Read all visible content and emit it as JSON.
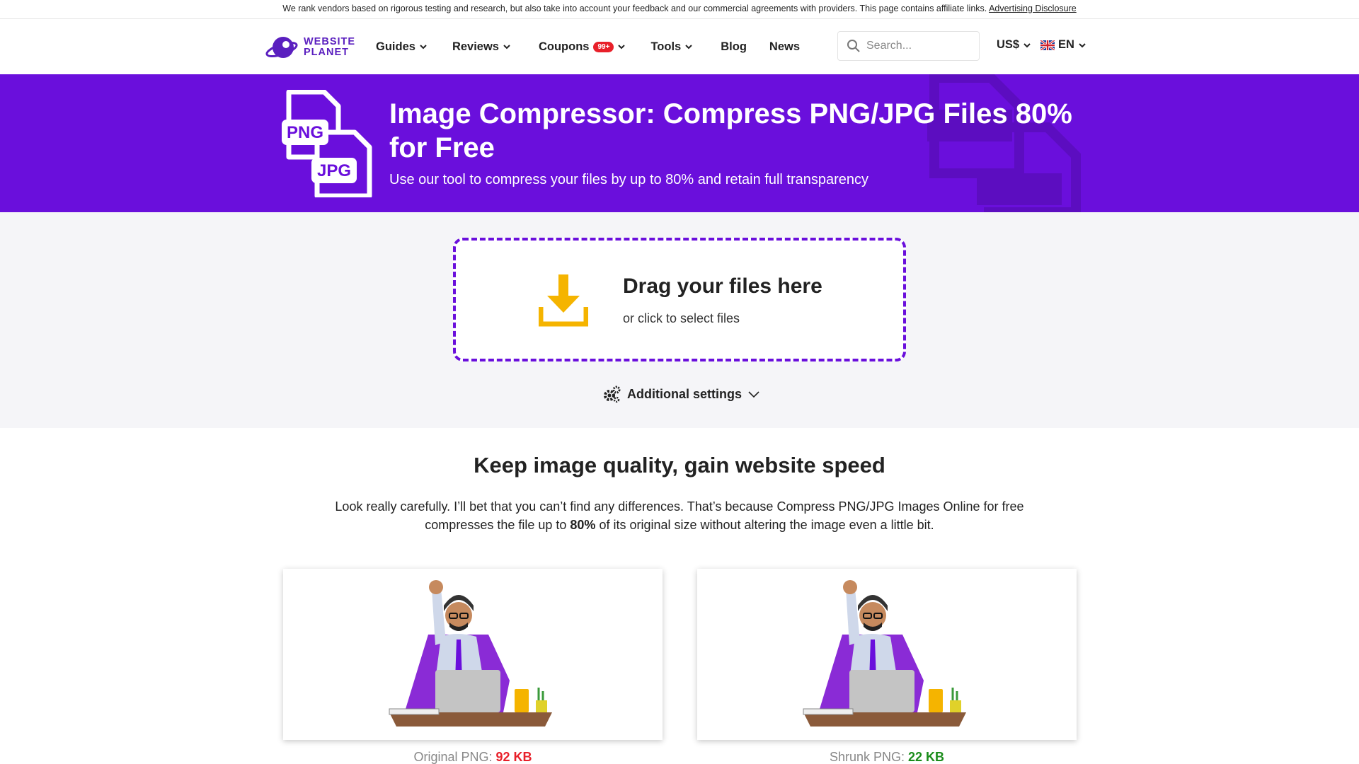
{
  "disclosure": {
    "text": "We rank vendors based on rigorous testing and research, but also take into account your feedback and our commercial agreements with providers. This page contains affiliate links.",
    "link": "Advertising Disclosure"
  },
  "header": {
    "logo_line1": "WEBSITE",
    "logo_line2": "PLANET",
    "nav": [
      {
        "label": "Guides"
      },
      {
        "label": "Reviews"
      },
      {
        "label": "Coupons",
        "badge": "99+"
      },
      {
        "label": "Tools"
      },
      {
        "label": "Blog"
      },
      {
        "label": "News"
      }
    ],
    "search_placeholder": "Search...",
    "currency": "US$",
    "language": "EN"
  },
  "hero": {
    "icon_png": "PNG",
    "icon_jpg": "JPG",
    "title": "Image Compressor: Compress PNG/JPG Files 80% for Free",
    "subtitle": "Use our tool to compress your files by up to 80% and retain full transparency"
  },
  "upload": {
    "title": "Drag your files here",
    "subtitle": "or click to select files",
    "settings_label": "Additional settings"
  },
  "content": {
    "title": "Keep image quality, gain website speed",
    "desc_part1": "Look really carefully. I’ll bet that you can’t find any differences. That’s because Compress PNG/JPG Images Online for free compresses the file up to ",
    "desc_bold": "80%",
    "desc_part2": " of its original size without altering the image even a little bit."
  },
  "comparison": [
    {
      "label": "Original PNG:",
      "size": "92 KB"
    },
    {
      "label": "Shrunk PNG:",
      "size": "22 KB"
    }
  ],
  "colors": {
    "brand_purple": "#6a0fdc",
    "upload_icon": "#f5b400",
    "badge_red": "#e8202a",
    "size_red": "#e8202a",
    "size_green": "#1a8c1a"
  }
}
